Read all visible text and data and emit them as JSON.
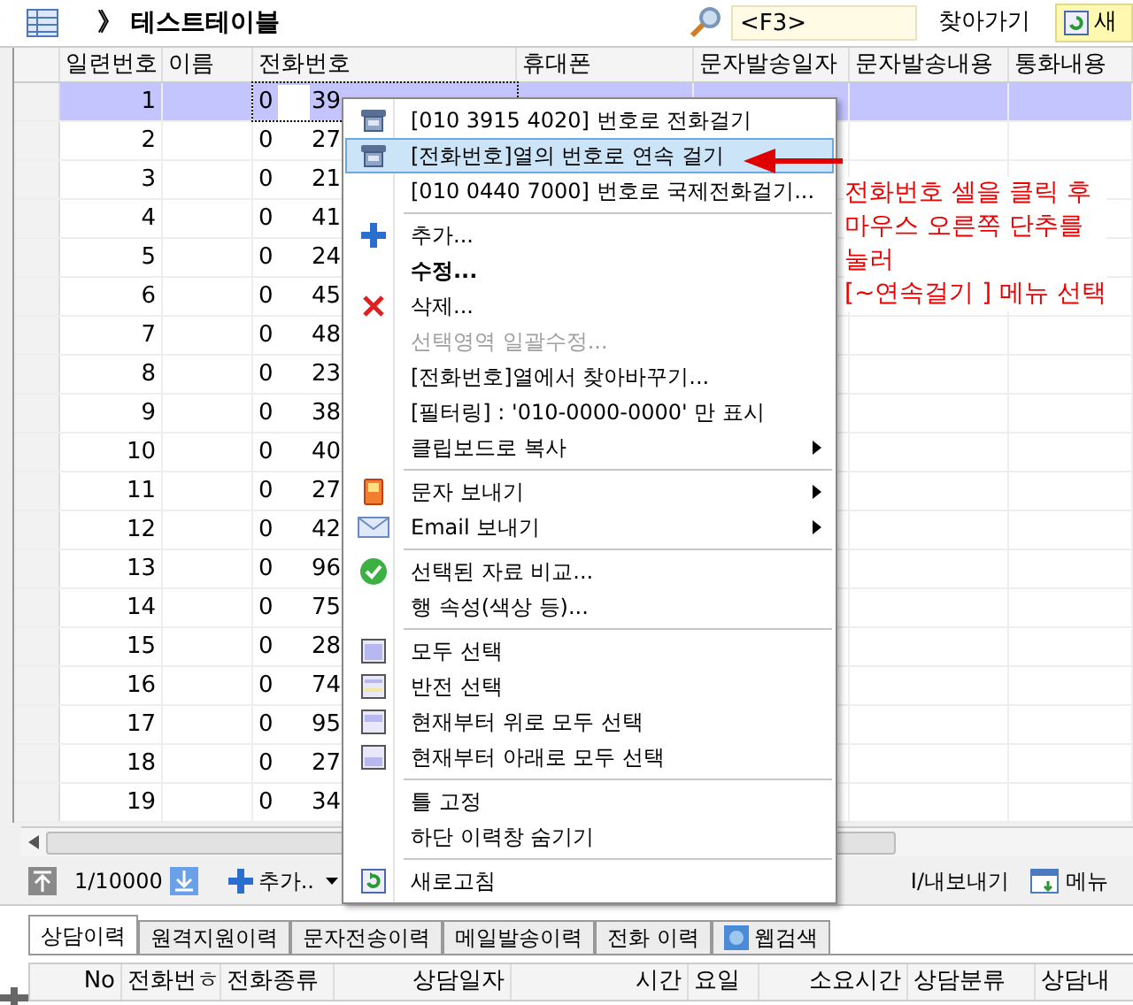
{
  "title": "》 테스트테이블",
  "search": {
    "placeholder": "<F3>",
    "button": "찾아가기",
    "refresh": "새"
  },
  "table": {
    "columns": [
      "일련번호",
      "이름",
      "전화번호",
      "휴대폰",
      "문자발송일자",
      "문자발송내용",
      "통화내용"
    ],
    "rows": [
      {
        "no": "1",
        "phone_head": "0",
        "phone_digits": "39",
        "selected": true
      },
      {
        "no": "2",
        "phone_head": "0",
        "phone_digits": "27",
        "selected": false
      },
      {
        "no": "3",
        "phone_head": "0",
        "phone_digits": "21",
        "selected": false
      },
      {
        "no": "4",
        "phone_head": "0",
        "phone_digits": "41",
        "selected": false
      },
      {
        "no": "5",
        "phone_head": "0",
        "phone_digits": "24",
        "selected": false
      },
      {
        "no": "6",
        "phone_head": "0",
        "phone_digits": "45",
        "selected": false
      },
      {
        "no": "7",
        "phone_head": "0",
        "phone_digits": "48",
        "selected": false
      },
      {
        "no": "8",
        "phone_head": "0",
        "phone_digits": "23",
        "selected": false
      },
      {
        "no": "9",
        "phone_head": "0",
        "phone_digits": "38",
        "selected": false
      },
      {
        "no": "10",
        "phone_head": "0",
        "phone_digits": "40",
        "selected": false
      },
      {
        "no": "11",
        "phone_head": "0",
        "phone_digits": "27",
        "selected": false
      },
      {
        "no": "12",
        "phone_head": "0",
        "phone_digits": "42",
        "selected": false
      },
      {
        "no": "13",
        "phone_head": "0",
        "phone_digits": "96",
        "selected": false
      },
      {
        "no": "14",
        "phone_head": "0",
        "phone_digits": "75",
        "selected": false
      },
      {
        "no": "15",
        "phone_head": "0",
        "phone_digits": "28",
        "selected": false
      },
      {
        "no": "16",
        "phone_head": "0",
        "phone_digits": "74",
        "selected": false
      },
      {
        "no": "17",
        "phone_head": "0",
        "phone_digits": "95",
        "selected": false
      },
      {
        "no": "18",
        "phone_head": "0",
        "phone_digits": "27",
        "selected": false
      },
      {
        "no": "19",
        "phone_head": "0",
        "phone_digits": "34",
        "selected": false
      }
    ]
  },
  "toolbar": {
    "counter": "1/10000",
    "add": "추가..",
    "export": "I/내보내기",
    "menu": "메뉴"
  },
  "bottom_tabs": [
    {
      "label": "상담이력",
      "selected": true
    },
    {
      "label": "원격지원이력",
      "selected": false
    },
    {
      "label": "문자전송이력",
      "selected": false
    },
    {
      "label": "메일발송이력",
      "selected": false
    },
    {
      "label": "전화 이력",
      "selected": false
    },
    {
      "label": "웹검색",
      "selected": false
    }
  ],
  "bottom_columns": [
    "No",
    "전화번ㅎ",
    "전화종류",
    "상담일자",
    "시간",
    "요일",
    "소요시간",
    "상담분류",
    "상담내"
  ],
  "context_menu": [
    {
      "kind": "item",
      "label": "[010 3915 4020] 번호로 전화걸기",
      "selected": false,
      "disabled": false,
      "bold": false,
      "submenu": false
    },
    {
      "kind": "item",
      "label": "[전화번호]열의 번호로 연속 걸기",
      "selected": true,
      "disabled": false,
      "bold": false,
      "submenu": false
    },
    {
      "kind": "item",
      "label": "[010 0440 7000] 번호로 국제전화걸기...",
      "selected": false,
      "disabled": false,
      "bold": false,
      "submenu": false
    },
    {
      "kind": "separator"
    },
    {
      "kind": "item",
      "label": "추가...",
      "selected": false,
      "disabled": false,
      "bold": false,
      "submenu": false
    },
    {
      "kind": "item",
      "label": "수정...",
      "selected": false,
      "disabled": false,
      "bold": true,
      "submenu": false
    },
    {
      "kind": "item",
      "label": "삭제...",
      "selected": false,
      "disabled": false,
      "bold": false,
      "submenu": false
    },
    {
      "kind": "item",
      "label": "선택영역 일괄수정...",
      "selected": false,
      "disabled": true,
      "bold": false,
      "submenu": false
    },
    {
      "kind": "item",
      "label": "[전화번호]열에서 찾아바꾸기...",
      "selected": false,
      "disabled": false,
      "bold": false,
      "submenu": false
    },
    {
      "kind": "item",
      "label": "[필터링] : '010-0000-0000' 만 표시",
      "selected": false,
      "disabled": false,
      "bold": false,
      "submenu": false
    },
    {
      "kind": "item",
      "label": "클립보드로 복사",
      "selected": false,
      "disabled": false,
      "bold": false,
      "submenu": true
    },
    {
      "kind": "separator"
    },
    {
      "kind": "item",
      "label": "문자 보내기",
      "selected": false,
      "disabled": false,
      "bold": false,
      "submenu": true
    },
    {
      "kind": "item",
      "label": "Email 보내기",
      "selected": false,
      "disabled": false,
      "bold": false,
      "submenu": true
    },
    {
      "kind": "separator"
    },
    {
      "kind": "item",
      "label": "선택된 자료 비교...",
      "selected": false,
      "disabled": false,
      "bold": false,
      "submenu": false
    },
    {
      "kind": "item",
      "label": "행 속성(색상 등)...",
      "selected": false,
      "disabled": false,
      "bold": false,
      "submenu": false
    },
    {
      "kind": "separator"
    },
    {
      "kind": "item",
      "label": "모두 선택",
      "selected": false,
      "disabled": false,
      "bold": false,
      "submenu": false
    },
    {
      "kind": "item",
      "label": "반전 선택",
      "selected": false,
      "disabled": false,
      "bold": false,
      "submenu": false
    },
    {
      "kind": "item",
      "label": "현재부터 위로 모두 선택",
      "selected": false,
      "disabled": false,
      "bold": false,
      "submenu": false
    },
    {
      "kind": "item",
      "label": "현재부터 아래로 모두 선택",
      "selected": false,
      "disabled": false,
      "bold": false,
      "submenu": false
    },
    {
      "kind": "separator"
    },
    {
      "kind": "item",
      "label": "틀 고정",
      "selected": false,
      "disabled": false,
      "bold": false,
      "submenu": false
    },
    {
      "kind": "item",
      "label": "하단 이력창 숨기기",
      "selected": false,
      "disabled": false,
      "bold": false,
      "submenu": false
    },
    {
      "kind": "separator"
    },
    {
      "kind": "item",
      "label": "새로고침",
      "selected": false,
      "disabled": false,
      "bold": false,
      "submenu": false
    }
  ],
  "annotation": {
    "lines": [
      "전화번호 셀을 클릭 후",
      "마우스 오른쪽 단추를",
      "눌러",
      "[~연속걸기 ] 메뉴 선택"
    ]
  }
}
